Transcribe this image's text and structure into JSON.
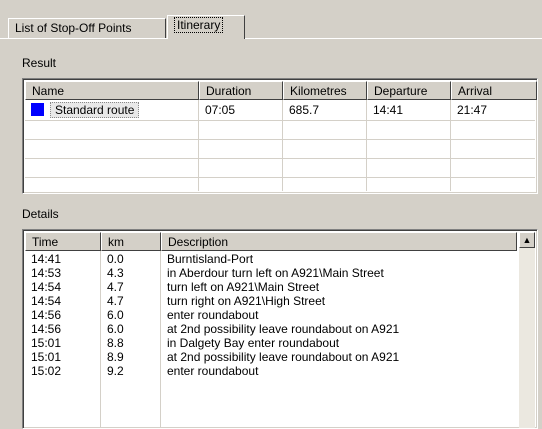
{
  "tabs": [
    {
      "label": "List of Stop-Off Points",
      "active": false
    },
    {
      "label": "Itinerary",
      "active": true
    }
  ],
  "result": {
    "label": "Result",
    "columns": [
      "Name",
      "Duration",
      "Kilometres",
      "Departure",
      "Arrival"
    ],
    "rows": [
      {
        "name": "Standard route",
        "color": "#0000ff",
        "duration": "07:05",
        "kilometres": "685.7",
        "departure": "14:41",
        "arrival": "21:47"
      }
    ]
  },
  "details": {
    "label": "Details",
    "columns": [
      "Time",
      "km",
      "Description"
    ],
    "rows": [
      {
        "time": "14:41",
        "km": "0.0",
        "description": "Burntisland-Port"
      },
      {
        "time": "14:53",
        "km": "4.3",
        "description": "in Aberdour turn left on A921\\Main Street"
      },
      {
        "time": "14:54",
        "km": "4.7",
        "description": "turn left on A921\\Main Street"
      },
      {
        "time": "14:54",
        "km": "4.7",
        "description": "turn right on A921\\High Street"
      },
      {
        "time": "14:56",
        "km": "6.0",
        "description": "enter roundabout"
      },
      {
        "time": "14:56",
        "km": "6.0",
        "description": "at 2nd possibility leave roundabout on A921"
      },
      {
        "time": "15:01",
        "km": "8.8",
        "description": "in Dalgety Bay enter roundabout"
      },
      {
        "time": "15:01",
        "km": "8.9",
        "description": "at 2nd possibility leave roundabout on A921"
      },
      {
        "time": "15:02",
        "km": "9.2",
        "description": "enter roundabout"
      }
    ]
  },
  "icons": {
    "scroll_up": "up-arrow-icon"
  }
}
